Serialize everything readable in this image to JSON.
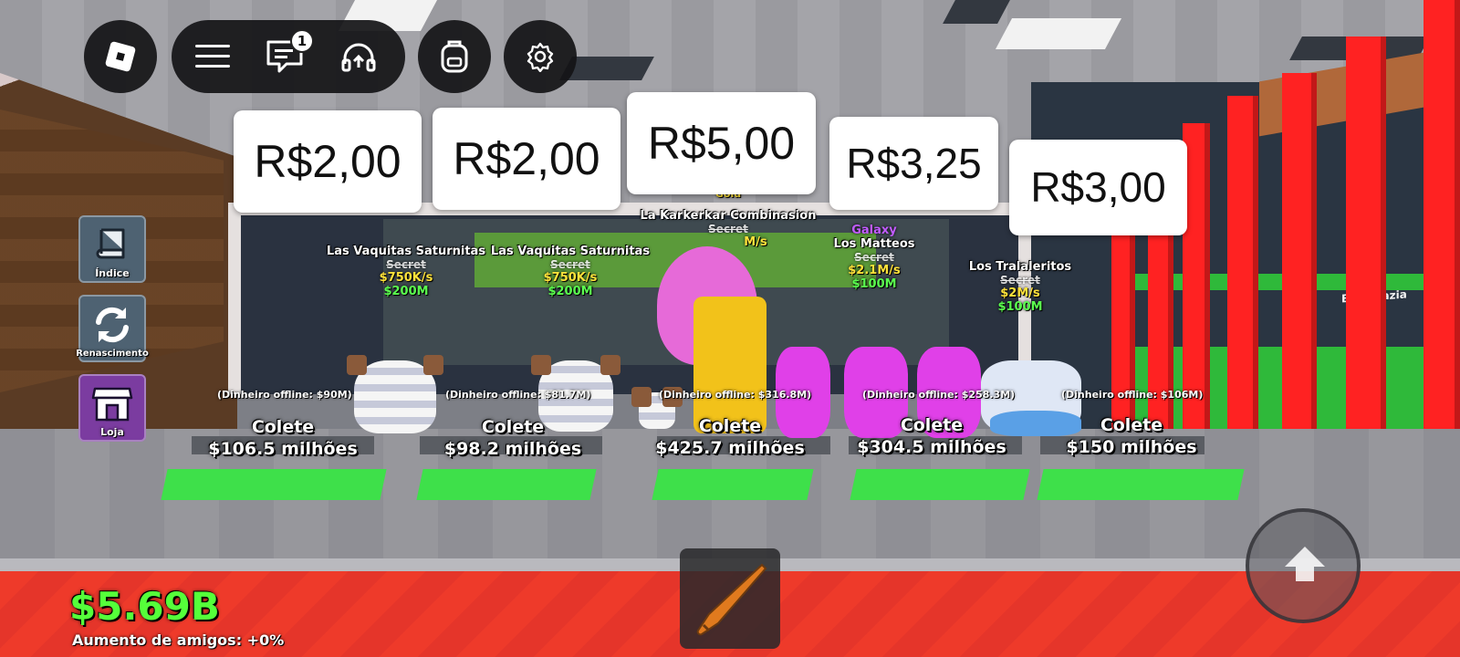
{
  "header": {
    "chat_badge": "1"
  },
  "price_cards": [
    "R$2,00",
    "R$2,00",
    "R$5,00",
    "R$3,25",
    "R$3,00"
  ],
  "side_menu": {
    "index": "Índice",
    "rebirth": "Renascimento",
    "shop": "Loja"
  },
  "pods": [
    {
      "name": "Las Vaquitas Saturnitas",
      "rarity": "Secret",
      "rate": "$750K/s",
      "price": "$200M"
    },
    {
      "name": "Las Vaquitas Saturnitas",
      "rarity": "Secret",
      "rate": "$750K/s",
      "price": "$200M"
    },
    {
      "mutation": "Gold",
      "name": "La Karkerkar Combinasion",
      "rarity": "Secret",
      "rate": "M/s"
    },
    {
      "mutation": "Galaxy",
      "name": "Los Matteos",
      "rarity": "Secret",
      "rate": "$2.1M/s",
      "price": "$100M"
    },
    {
      "name": "Los Tralaleritos",
      "rarity": "Secret",
      "rate": "$2M/s",
      "price": "$100M"
    }
  ],
  "collectors": [
    {
      "offline": "(Dinheiro offline: $90M)",
      "label": "Colete",
      "amount": "$106.5 milhões"
    },
    {
      "offline": "(Dinheiro offline: $81.7M)",
      "label": "Colete",
      "amount": "$98.2 milhões"
    },
    {
      "offline": "(Dinheiro offline: $316.8M)",
      "label": "Colete",
      "amount": "$425.7 milhões"
    },
    {
      "offline": "(Dinheiro offline: $258.3M)",
      "label": "Colete",
      "amount": "$304.5 milhões"
    },
    {
      "offline": "(Dinheiro offline: $106M)",
      "label": "Colete",
      "amount": "$150 milhões"
    }
  ],
  "sign": "Base vazia",
  "money": "$5.69B",
  "friend_boost": "Aumento de amigos: +0%",
  "colors": {
    "money": "#55ff3a",
    "floor_red": "#ee3a2a",
    "pad": "#3ee04a",
    "pillar": "#ff2222"
  },
  "icons": [
    "roblox-logo-icon",
    "menu-icon",
    "chat-icon",
    "headset-icon",
    "backpack-icon",
    "gear-icon",
    "book-icon",
    "refresh-icon",
    "shop-icon",
    "bat-icon",
    "up-arrow-icon"
  ]
}
